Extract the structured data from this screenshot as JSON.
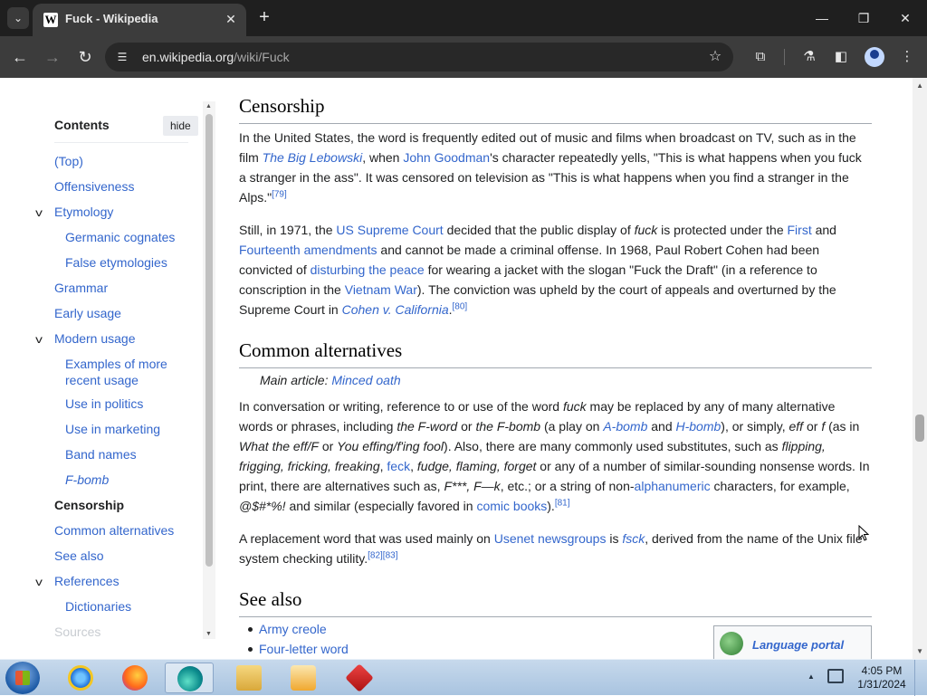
{
  "browser": {
    "tab_title": "Fuck - Wikipedia",
    "favicon_letter": "W",
    "url_domain": "en.wikipedia.org",
    "url_path": "/wiki/Fuck"
  },
  "toc": {
    "header": "Contents",
    "hide_label": "hide",
    "items": [
      {
        "label": "(Top)"
      },
      {
        "label": "Offensiveness"
      },
      {
        "label": "Etymology"
      },
      {
        "label": "Germanic cognates"
      },
      {
        "label": "False etymologies"
      },
      {
        "label": "Grammar"
      },
      {
        "label": "Early usage"
      },
      {
        "label": "Modern usage"
      },
      {
        "label": "Examples of more"
      },
      {
        "label": "recent usage"
      },
      {
        "label": "Use in politics"
      },
      {
        "label": "Use in marketing"
      },
      {
        "label": "Band names"
      },
      {
        "label": "F-bomb"
      },
      {
        "label": "Censorship"
      },
      {
        "label": "Common alternatives"
      },
      {
        "label": "See also"
      },
      {
        "label": "References"
      },
      {
        "label": "Dictionaries"
      },
      {
        "label": "Sources"
      }
    ]
  },
  "content": {
    "censorship_heading": "Censorship",
    "p1": {
      "t1": "In the United States, the word is frequently edited out of music and films when broadcast on TV, such as in the film ",
      "l1": "The Big Lebowski",
      "t2": ", when ",
      "l2": "John Goodman",
      "t3": "'s character repeatedly yells, \"This is what happens when you fuck a stranger in the ass\". It was censored on television as \"This is what happens when you find a stranger in the Alps.\"",
      "ref": "[79]"
    },
    "p2": {
      "t1": "Still, in 1971, the ",
      "l1": "US Supreme Court",
      "t2": " decided that the public display of ",
      "i1": "fuck",
      "t3": " is protected under the ",
      "l2": "First",
      "t4": " and ",
      "l3": "Fourteenth amendments",
      "t5": " and cannot be made a criminal offense. In 1968, Paul Robert Cohen had been convicted of ",
      "l4": "disturbing the peace",
      "t6": " for wearing a jacket with the slogan \"Fuck the Draft\" (in a reference to conscription in the ",
      "l5": "Vietnam War",
      "t7": "). The conviction was upheld by the court of appeals and overturned by the Supreme Court in ",
      "l6": "Cohen v. California",
      "t8": ".",
      "ref": "[80]"
    },
    "alternatives_heading": "Common alternatives",
    "hatnote_label": "Main article: ",
    "hatnote_link": "Minced oath",
    "p3": {
      "t1": "In conversation or writing, reference to or use of the word ",
      "i1": "fuck",
      "t2": " may be replaced by any of many alternative words or phrases, including ",
      "i2": "the F-word",
      "t3": " or ",
      "i3": "the F-bomb",
      "t4": " (a play on ",
      "l1": "A-bomb",
      "t5": " and ",
      "l2": "H-bomb",
      "t6": "), or simply, ",
      "i4": "eff",
      "t7": " or ",
      "i5": "f",
      "t8": " (as in ",
      "i6": "What the eff/F",
      "t9": " or ",
      "i7": "You effing/f'ing fool",
      "t10": "). Also, there are many commonly used substitutes, such as ",
      "i8": "flipping, frigging, fricking, freaking",
      "t11": ", ",
      "l3": "feck",
      "t12": ", ",
      "i9": "fudge, flaming, forget",
      "t13": " or any of a number of similar-sounding nonsense words. In print, there are alternatives such as, ",
      "i10": "F***, F—k",
      "t14": ", etc.; or a string of non-",
      "l4": "alphanumeric",
      "t15": " characters, for example, ",
      "i11": "@$#*%!",
      "t16": " and similar (especially favored in ",
      "l5": "comic books",
      "t17": ").",
      "ref": "[81]"
    },
    "p4": {
      "t1": "A replacement word that was used mainly on ",
      "l1": "Usenet newsgroups",
      "t2": " is ",
      "i1": "fsck",
      "t3": ", derived from the name of the Unix file system checking utility.",
      "ref": "[82][83]"
    },
    "see_also_heading": "See also",
    "see_also_items": [
      "Army creole",
      "Four-letter word"
    ],
    "portal_label": "Language portal"
  },
  "taskbar": {
    "time": "4:05 PM",
    "date": "1/31/2024"
  },
  "colors": {
    "link": "#3366cc",
    "text": "#202122",
    "chrome_dark": "#3c3c3c"
  }
}
